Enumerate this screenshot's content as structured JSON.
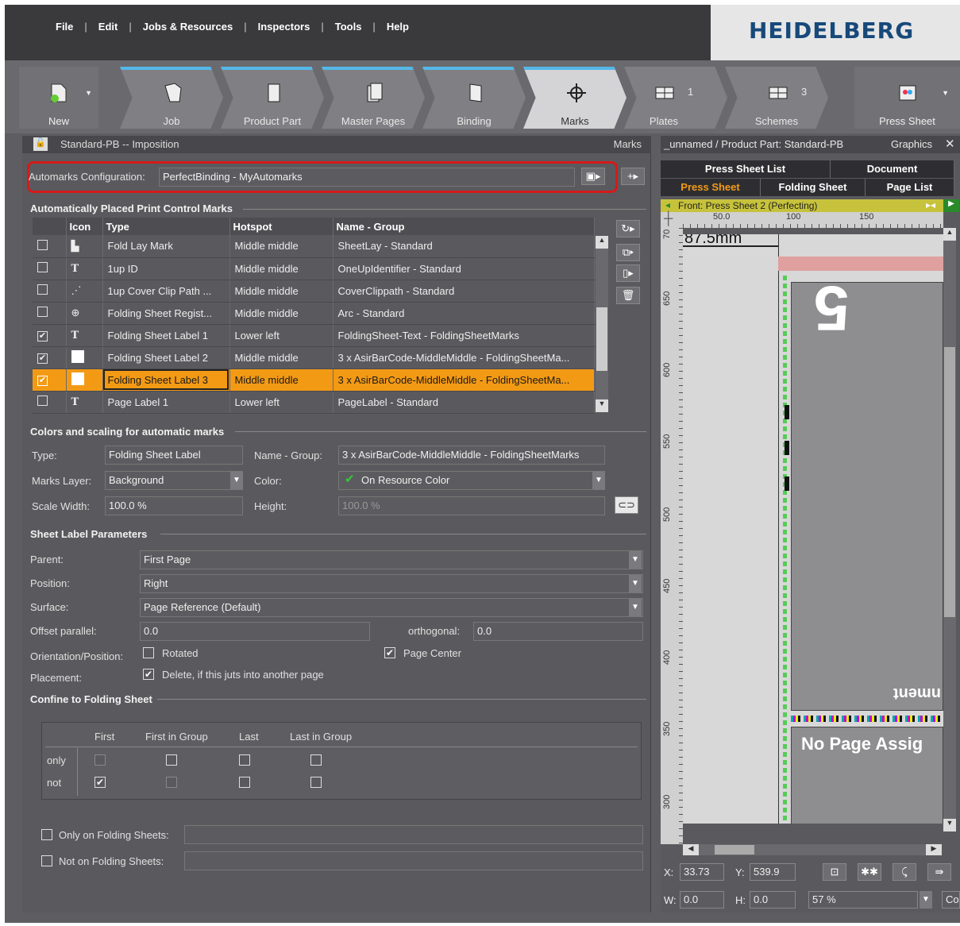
{
  "menu": [
    "File",
    "Edit",
    "Jobs & Resources",
    "Inspectors",
    "Tools",
    "Help"
  ],
  "brand": "HEIDELBERG",
  "workflow": {
    "new_label": "New",
    "steps": [
      {
        "label": "Job"
      },
      {
        "label": "Product Part"
      },
      {
        "label": "Master Pages"
      },
      {
        "label": "Binding"
      },
      {
        "label": "Marks",
        "active": true
      },
      {
        "label": "Plates",
        "count": "1"
      },
      {
        "label": "Schemes",
        "count": "3"
      }
    ],
    "press_sheet_label": "Press Sheet"
  },
  "left_panel": {
    "title": "Standard-PB -- Imposition",
    "title_right": "Marks",
    "config_label": "Automarks Configuration:",
    "config_value": "PerfectBinding - MyAutomarks",
    "section_auto": "Automatically Placed Print Control Marks",
    "table": {
      "headers": [
        "Icon",
        "Type",
        "Hotspot",
        "Name - Group"
      ],
      "rows": [
        {
          "checked": false,
          "icon": "fold-lay-icon",
          "type": "Fold Lay Mark",
          "hotspot": "Middle middle",
          "name": "SheetLay - Standard"
        },
        {
          "checked": false,
          "icon": "T",
          "type": "1up ID",
          "hotspot": "Middle middle",
          "name": "OneUpIdentifier - Standard"
        },
        {
          "checked": false,
          "icon": "wand-icon",
          "type": "1up Cover Clip Path ...",
          "hotspot": "Middle middle",
          "name": "CoverClippath - Standard"
        },
        {
          "checked": false,
          "icon": "register-icon",
          "type": "Folding Sheet Regist...",
          "hotspot": "Middle middle",
          "name": "Arc - Standard"
        },
        {
          "checked": true,
          "icon": "T",
          "type": "Folding Sheet Label 1",
          "hotspot": "Lower left",
          "name": "FoldingSheet-Text - FoldingSheetMarks"
        },
        {
          "checked": true,
          "icon": "blank-icon",
          "type": "Folding Sheet Label 2",
          "hotspot": "Middle middle",
          "name": "3 x AsirBarCode-MiddleMiddle - FoldingSheetMa..."
        },
        {
          "checked": true,
          "icon": "blank-icon",
          "type": "Folding Sheet Label 3",
          "hotspot": "Middle middle",
          "name": "3 x AsirBarCode-MiddleMiddle - FoldingSheetMa...",
          "selected": true
        },
        {
          "checked": false,
          "icon": "T",
          "type": "Page Label 1",
          "hotspot": "Lower left",
          "name": "PageLabel - Standard"
        }
      ]
    },
    "section_colors": "Colors and scaling for automatic marks",
    "type_label": "Type:",
    "type_value": "Folding Sheet Label",
    "name_group_label": "Name - Group:",
    "name_group_value": "3 x AsirBarCode-MiddleMiddle - FoldingSheetMarks",
    "marks_layer_label": "Marks Layer:",
    "marks_layer_value": "Background",
    "color_label": "Color:",
    "color_value": "On Resource Color",
    "scale_width_label": "Scale Width:",
    "scale_width_value": "100.0 %",
    "height_label": "Height:",
    "height_value": "100.0 %",
    "section_sheet_label": "Sheet Label Parameters",
    "parent_label": "Parent:",
    "parent_value": "First Page",
    "position_label": "Position:",
    "position_value": "Right",
    "surface_label": "Surface:",
    "surface_value": "Page Reference (Default)",
    "offset_label": "Offset parallel:",
    "offset_value": "0.0",
    "orth_label": "orthogonal:",
    "orth_value": "0.0",
    "orient_label": "Orientation/Position:",
    "rotated_label": "Rotated",
    "page_center_label": "Page Center",
    "placement_label": "Placement:",
    "delete_label": "Delete, if this juts into another page",
    "section_confine": "Confine to Folding Sheet",
    "confine_cols": [
      "First",
      "First in Group",
      "Last",
      "Last in Group"
    ],
    "confine_rows": [
      "only",
      "not"
    ],
    "only_on_label": "Only on Folding Sheets:",
    "not_on_label": "Not on Folding Sheets:"
  },
  "right_panel": {
    "title": "_unnamed / Product Part: Standard-PB",
    "title_right": "Graphics",
    "tabs1": [
      "Press Sheet List",
      "Document"
    ],
    "tabs2": [
      "Press Sheet",
      "Folding Sheet",
      "Page List"
    ],
    "sheet_bar": "Front: Press Sheet 2 (Perfecting)",
    "ruler_top": [
      "50.0",
      "100",
      "150"
    ],
    "ruler_left": [
      "70",
      "650",
      "600",
      "550",
      "500",
      "450",
      "400",
      "350",
      "300"
    ],
    "measure": "87.5mm",
    "page_num": "5",
    "page_text": "nment",
    "no_page": "No Page Assig",
    "x_label": "X:",
    "x_value": "33.73",
    "y_label": "Y:",
    "y_value": "539.9",
    "w_label": "W:",
    "w_value": "0.0",
    "h_label": "H:",
    "h_value": "0.0",
    "zoom": "57 %",
    "zoom_extra": "Co"
  }
}
